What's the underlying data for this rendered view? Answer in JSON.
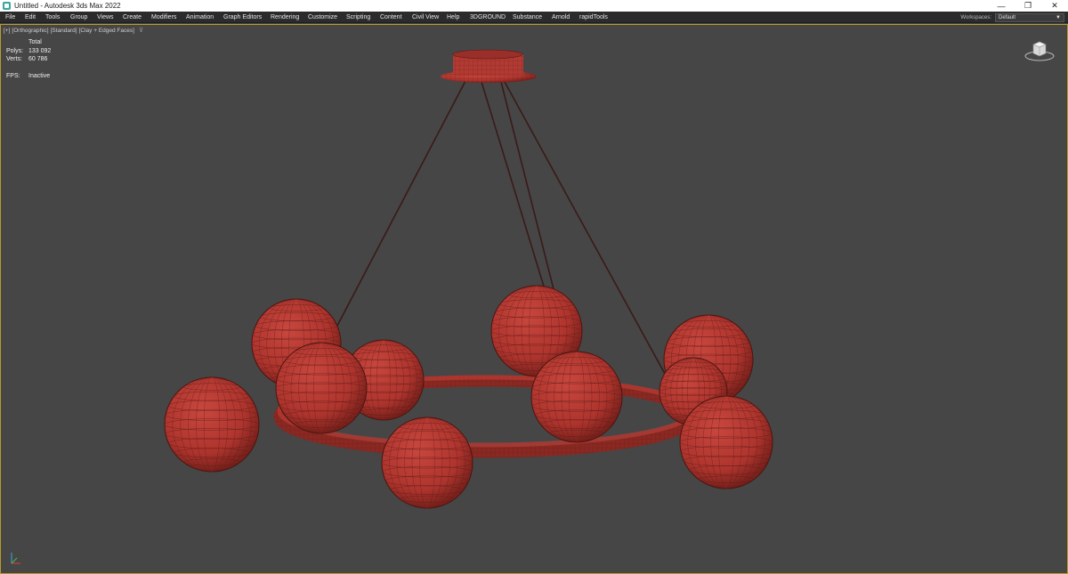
{
  "window": {
    "title": "Untitled - Autodesk 3ds Max 2022",
    "controls": {
      "minimize": "—",
      "restore": "❐",
      "close": "✕"
    }
  },
  "menubar": {
    "items": [
      "File",
      "Edit",
      "Tools",
      "Group",
      "Views",
      "Create",
      "Modifiers",
      "Animation",
      "Graph Editors",
      "Rendering",
      "Customize",
      "Scripting",
      "Content",
      "Civil View",
      "Help",
      "3DGROUND",
      "Substance",
      "Arnold",
      "rapidTools"
    ],
    "workspaces_label": "Workspaces:",
    "workspaces_value": "Default"
  },
  "viewport": {
    "labels": [
      "[+]",
      "[Orthographic]",
      "[Standard]",
      "[Clay + Edged Faces]"
    ],
    "stats": {
      "header": "Total",
      "polys_label": "Polys:",
      "polys_value": "133 092",
      "verts_label": "Verts:",
      "verts_value": "60 786",
      "fps_label": "FPS:",
      "fps_value": "Inactive"
    },
    "colors": {
      "background": "#464646",
      "clay": "#b83a32",
      "wire": "#5a1a16",
      "active_border": "#b89c2c"
    }
  }
}
